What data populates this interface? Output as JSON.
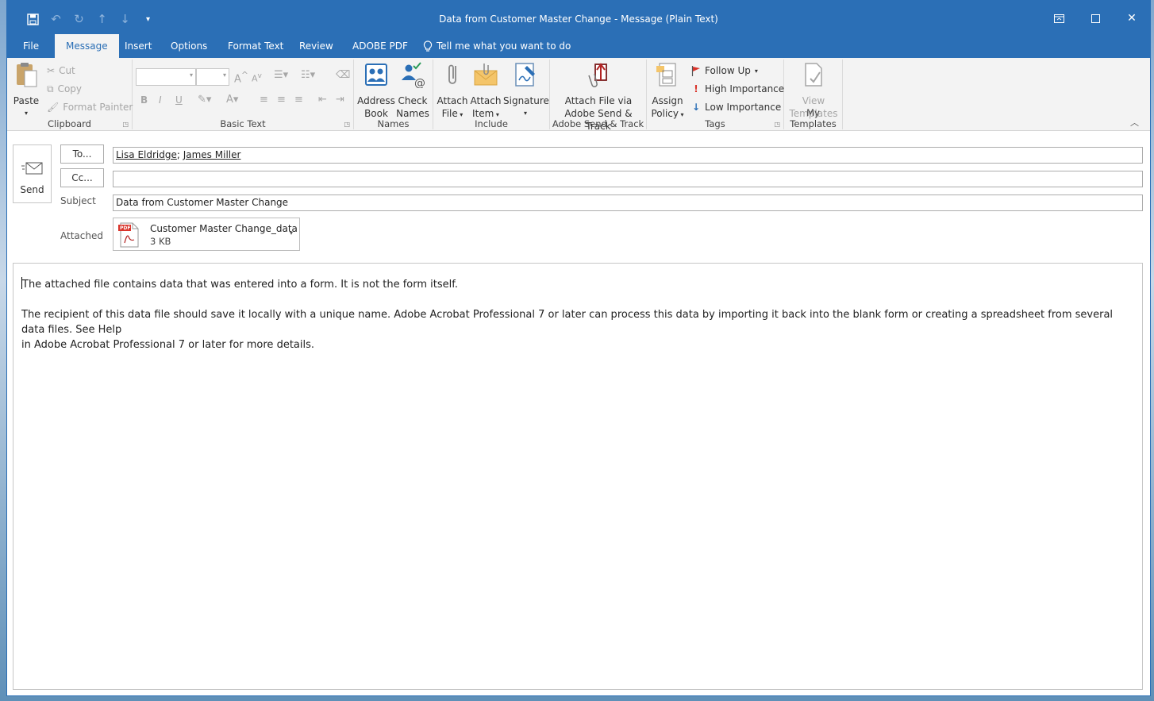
{
  "window": {
    "title": "Data from Customer Master Change  -  Message (Plain Text)"
  },
  "qat": {
    "save_icon": "save-icon",
    "undo_icon": "undo-icon",
    "redo_icon": "redo-icon",
    "up_icon": "up-arrow-icon",
    "down_icon": "down-arrow-icon",
    "customize_icon": "customize-icon"
  },
  "tabs": [
    {
      "label": "File"
    },
    {
      "label": "Message"
    },
    {
      "label": "Insert"
    },
    {
      "label": "Options"
    },
    {
      "label": "Format Text"
    },
    {
      "label": "Review"
    },
    {
      "label": "ADOBE PDF"
    }
  ],
  "tell_me": "Tell me what you want to do",
  "ribbon": {
    "clipboard": {
      "label": "Clipboard",
      "paste": "Paste",
      "cut": "Cut",
      "copy": "Copy",
      "format_painter": "Format Painter"
    },
    "basic_text": {
      "label": "Basic Text",
      "bold": "B",
      "italic": "I",
      "underline": "U",
      "font_color": "A",
      "grow": "A",
      "shrink": "A"
    },
    "names": {
      "label": "Names",
      "address_book_1": "Address",
      "address_book_2": "Book",
      "check_names_1": "Check",
      "check_names_2": "Names"
    },
    "include": {
      "label": "Include",
      "attach_file_1": "Attach",
      "attach_file_2": "File",
      "attach_item_1": "Attach",
      "attach_item_2": "Item",
      "signature": "Signature"
    },
    "adobe": {
      "label": "Adobe Send & Track",
      "btn_1": "Attach File via",
      "btn_2": "Adobe Send & Track"
    },
    "tags": {
      "label": "Tags",
      "assign_1": "Assign",
      "assign_2": "Policy",
      "follow_up": "Follow Up",
      "high": "High Importance",
      "low": "Low Importance"
    },
    "templates": {
      "label": "My Templates",
      "view_1": "View",
      "view_2": "Templates"
    }
  },
  "compose": {
    "send": "Send",
    "to_button": "To...",
    "cc_button": "Cc...",
    "subject_label": "Subject",
    "attached_label": "Attached",
    "to_recipients": [
      "Lisa Eldridge",
      "James Miller"
    ],
    "cc_value": "",
    "subject_value": "Data from Customer Master Change",
    "attachment": {
      "name": "Customer Master Change_data",
      "size": "3 KB",
      "badge": "PDF"
    },
    "body": [
      "The attached file contains data that was entered into a form. It is not the form itself.",
      "The recipient of this data file should save it locally with a unique name. Adobe Acrobat Professional 7 or later can process this data by importing it back into the blank form or creating a spreadsheet from several data files. See Help\nin Adobe Acrobat Professional 7 or later for more details."
    ]
  }
}
